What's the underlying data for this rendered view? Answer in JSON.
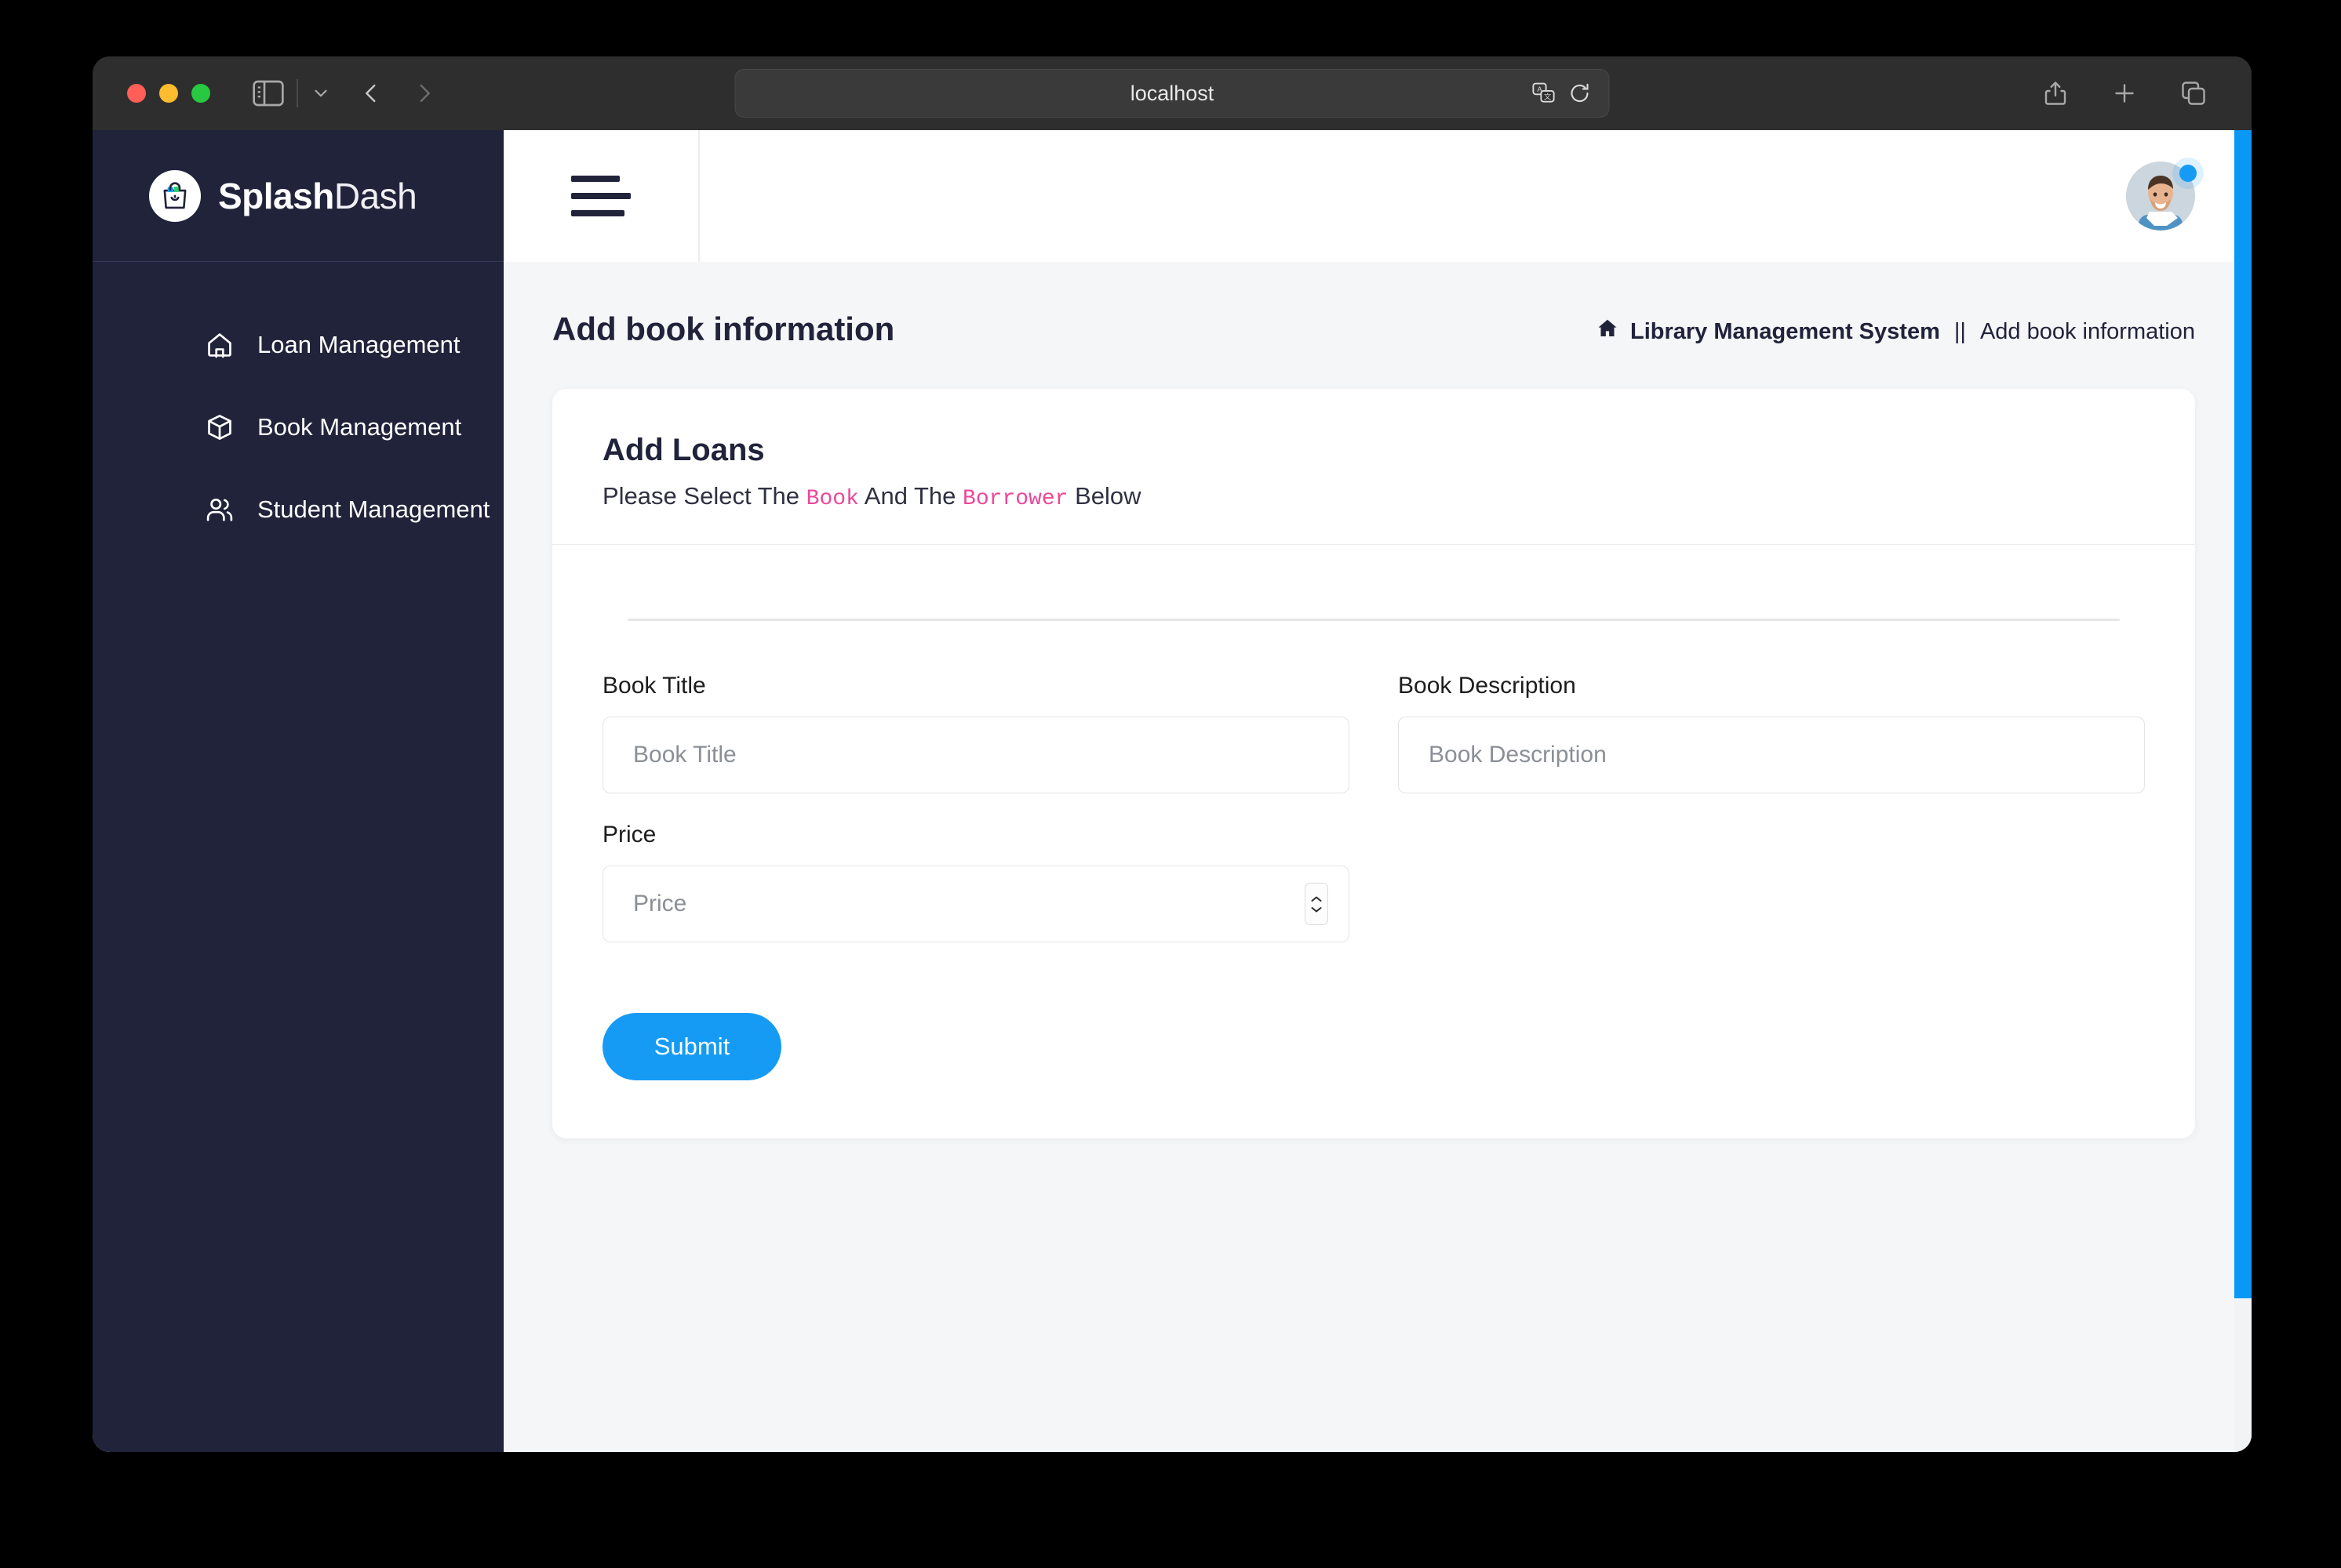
{
  "browser": {
    "url": "localhost",
    "traffic_lights": [
      "close",
      "minimize",
      "maximize"
    ],
    "icons": {
      "sidebar_toggle": "sidebar-toggle-icon",
      "tab_dropdown": "chevron-down-icon",
      "back": "chevron-left-icon",
      "forward": "chevron-right-icon",
      "translate": "translate-icon",
      "reload": "reload-icon",
      "share": "share-icon",
      "new_tab": "plus-icon",
      "tab_overview": "tab-overview-icon"
    }
  },
  "sidebar": {
    "brand": {
      "name_bold": "Splash",
      "name_light": "Dash",
      "logo_icon": "shopping-bag-icon"
    },
    "items": [
      {
        "label": "Loan Management",
        "icon": "home-icon"
      },
      {
        "label": "Book Management",
        "icon": "box-icon"
      },
      {
        "label": "Student Management",
        "icon": "users-icon"
      }
    ]
  },
  "topbar": {
    "menu_icon": "hamburger-menu-icon",
    "avatar_icon": "user-avatar",
    "status": "online"
  },
  "page": {
    "title": "Add book information",
    "breadcrumb": {
      "home_icon": "home-icon",
      "root": "Library Management System",
      "separator": "||",
      "current": "Add book information"
    }
  },
  "card": {
    "title": "Add Loans",
    "subtitle": {
      "part1": "Please Select The",
      "code1": "Book",
      "part2": "And The",
      "code2": "Borrower",
      "part3": "Below"
    },
    "fields": [
      {
        "label": "Book Title",
        "placeholder": "Book Title",
        "value": "",
        "type": "text"
      },
      {
        "label": "Book Description",
        "placeholder": "Book Description",
        "value": "",
        "type": "text"
      },
      {
        "label": "Price",
        "placeholder": "Price",
        "value": "",
        "type": "number"
      }
    ],
    "submit_label": "Submit"
  },
  "colors": {
    "sidebar_bg": "#20233a",
    "accent_blue": "#169bf5",
    "code_pink": "#ec4899",
    "content_bg": "#f5f6f8",
    "scrollbar": "#0a98f5"
  }
}
